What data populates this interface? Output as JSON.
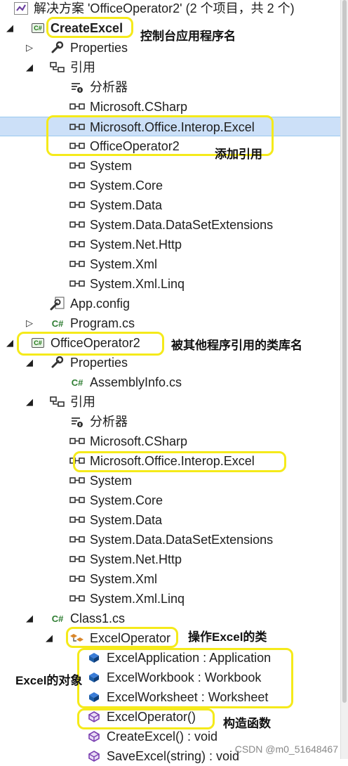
{
  "solution": {
    "title": "解决方案 'OfficeOperator2' (2 个项目，共 2 个)"
  },
  "tree": [
    {
      "name": "solution-node",
      "label": "解决方案 'OfficeOperator2' (2 个项目，共 2 个)",
      "icon": "vs-solution-icon",
      "indent": 0,
      "arrow": "none",
      "bold": false
    },
    {
      "name": "project-createexcel",
      "label": "CreateExcel",
      "icon": "csharp-project-icon",
      "indent": 1,
      "arrow": "expanded",
      "bold": true
    },
    {
      "name": "properties-folder",
      "label": "Properties",
      "icon": "wrench-icon",
      "indent": 2,
      "arrow": "collapsed",
      "bold": false
    },
    {
      "name": "references-folder",
      "label": "引用",
      "icon": "references-icon",
      "indent": 2,
      "arrow": "expanded",
      "bold": false
    },
    {
      "name": "reference-analyzer",
      "label": "分析器",
      "icon": "analyzer-icon",
      "indent": 3,
      "arrow": "none",
      "bold": false
    },
    {
      "name": "reference-item",
      "label": "Microsoft.CSharp",
      "icon": "reference-icon",
      "indent": 3,
      "arrow": "none",
      "bold": false
    },
    {
      "name": "reference-item-selected",
      "label": "Microsoft.Office.Interop.Excel",
      "icon": "reference-icon",
      "indent": 3,
      "arrow": "none",
      "bold": false,
      "selected": true
    },
    {
      "name": "reference-item",
      "label": "OfficeOperator2",
      "icon": "reference-icon",
      "indent": 3,
      "arrow": "none",
      "bold": false
    },
    {
      "name": "reference-item",
      "label": "System",
      "icon": "reference-icon",
      "indent": 3,
      "arrow": "none",
      "bold": false
    },
    {
      "name": "reference-item",
      "label": "System.Core",
      "icon": "reference-icon",
      "indent": 3,
      "arrow": "none",
      "bold": false
    },
    {
      "name": "reference-item",
      "label": "System.Data",
      "icon": "reference-icon",
      "indent": 3,
      "arrow": "none",
      "bold": false
    },
    {
      "name": "reference-item",
      "label": "System.Data.DataSetExtensions",
      "icon": "reference-icon",
      "indent": 3,
      "arrow": "none",
      "bold": false
    },
    {
      "name": "reference-item",
      "label": "System.Net.Http",
      "icon": "reference-icon",
      "indent": 3,
      "arrow": "none",
      "bold": false
    },
    {
      "name": "reference-item",
      "label": "System.Xml",
      "icon": "reference-icon",
      "indent": 3,
      "arrow": "none",
      "bold": false
    },
    {
      "name": "reference-item",
      "label": "System.Xml.Linq",
      "icon": "reference-icon",
      "indent": 3,
      "arrow": "none",
      "bold": false
    },
    {
      "name": "file-app-config",
      "label": "App.config",
      "icon": "config-icon",
      "indent": 2,
      "arrow": "none",
      "bold": false
    },
    {
      "name": "file-program-cs",
      "label": "Program.cs",
      "icon": "csharp-file-icon",
      "indent": 2,
      "arrow": "collapsed",
      "bold": false
    },
    {
      "name": "project-officeoperator2",
      "label": "OfficeOperator2",
      "icon": "csharp-project-icon",
      "indent": 1,
      "arrow": "expanded",
      "bold": false
    },
    {
      "name": "properties-folder",
      "label": "Properties",
      "icon": "wrench-icon",
      "indent": 2,
      "arrow": "expanded",
      "bold": false
    },
    {
      "name": "file-assemblyinfo",
      "label": "AssemblyInfo.cs",
      "icon": "csharp-file-icon",
      "indent": 3,
      "arrow": "none",
      "bold": false
    },
    {
      "name": "references-folder",
      "label": "引用",
      "icon": "references-icon",
      "indent": 2,
      "arrow": "expanded",
      "bold": false
    },
    {
      "name": "reference-analyzer",
      "label": "分析器",
      "icon": "analyzer-icon",
      "indent": 3,
      "arrow": "none",
      "bold": false
    },
    {
      "name": "reference-item",
      "label": "Microsoft.CSharp",
      "icon": "reference-icon",
      "indent": 3,
      "arrow": "none",
      "bold": false
    },
    {
      "name": "reference-item",
      "label": "Microsoft.Office.Interop.Excel",
      "icon": "reference-icon",
      "indent": 3,
      "arrow": "none",
      "bold": false
    },
    {
      "name": "reference-item",
      "label": "System",
      "icon": "reference-icon",
      "indent": 3,
      "arrow": "none",
      "bold": false
    },
    {
      "name": "reference-item",
      "label": "System.Core",
      "icon": "reference-icon",
      "indent": 3,
      "arrow": "none",
      "bold": false
    },
    {
      "name": "reference-item",
      "label": "System.Data",
      "icon": "reference-icon",
      "indent": 3,
      "arrow": "none",
      "bold": false
    },
    {
      "name": "reference-item",
      "label": "System.Data.DataSetExtensions",
      "icon": "reference-icon",
      "indent": 3,
      "arrow": "none",
      "bold": false
    },
    {
      "name": "reference-item",
      "label": "System.Net.Http",
      "icon": "reference-icon",
      "indent": 3,
      "arrow": "none",
      "bold": false
    },
    {
      "name": "reference-item",
      "label": "System.Xml",
      "icon": "reference-icon",
      "indent": 3,
      "arrow": "none",
      "bold": false
    },
    {
      "name": "reference-item",
      "label": "System.Xml.Linq",
      "icon": "reference-icon",
      "indent": 3,
      "arrow": "none",
      "bold": false
    },
    {
      "name": "file-class1-cs",
      "label": "Class1.cs",
      "icon": "csharp-file-icon",
      "indent": 2,
      "arrow": "expanded",
      "bold": false
    },
    {
      "name": "class-exceloperator",
      "label": "ExcelOperator",
      "icon": "class-icon",
      "indent": 3,
      "arrow": "expanded",
      "bold": false
    },
    {
      "name": "member-field",
      "label": "ExcelApplication : Application",
      "icon": "field-icon",
      "indent": 4,
      "arrow": "none",
      "bold": false
    },
    {
      "name": "member-field",
      "label": "ExcelWorkbook : Workbook",
      "icon": "field-icon",
      "indent": 4,
      "arrow": "none",
      "bold": false
    },
    {
      "name": "member-field",
      "label": "ExcelWorksheet : Worksheet",
      "icon": "field-icon",
      "indent": 4,
      "arrow": "none",
      "bold": false
    },
    {
      "name": "member-method",
      "label": "ExcelOperator()",
      "icon": "method-icon",
      "indent": 4,
      "arrow": "none",
      "bold": false
    },
    {
      "name": "member-method",
      "label": "CreateExcel() : void",
      "icon": "method-icon",
      "indent": 4,
      "arrow": "none",
      "bold": false
    },
    {
      "name": "member-method",
      "label": "SaveExcel(string) : void",
      "icon": "method-icon",
      "indent": 4,
      "arrow": "none",
      "bold": false
    }
  ],
  "annotations": {
    "console_app_name": "控制台应用程序名",
    "add_reference": "添加引用",
    "class_library_name": "被其他程序引用的类库名",
    "excel_class": "操作Excel的类",
    "excel_objects": "Excel的对象",
    "constructor": "构造函数"
  },
  "watermark": "CSDN @m0_51648467",
  "colors": {
    "highlight": "#f5ea1a",
    "selected_row": "#cce0f8",
    "csharp_green": "#2e7d32",
    "field_blue": "#1f5fa8",
    "method_purple": "#7a3fb0",
    "class_orange": "#d9862a"
  }
}
